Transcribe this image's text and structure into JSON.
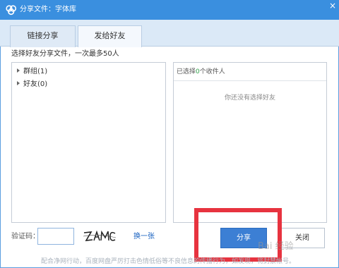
{
  "window": {
    "title": "分享文件：字体库",
    "close_glyph": "×",
    "app_icon": "cloud-icon",
    "accent_color": "#3a8fdf"
  },
  "tabs": [
    {
      "label": "链接分享",
      "active": false
    },
    {
      "label": "发给好友",
      "active": true
    }
  ],
  "instruction": "选择好友分享文件，一次最多50人",
  "contacts": {
    "groups_label": "群组(1)",
    "friends_label": "好友(0)"
  },
  "selected": {
    "prefix": "已选择",
    "count": "0",
    "suffix": "个收件人",
    "empty_text": "你还没有选择好友"
  },
  "captcha": {
    "label": "验证码：",
    "value": "",
    "refresh_label": "换一张"
  },
  "buttons": {
    "share_label": "分享",
    "close_label": "关闭",
    "share_color": "#3c7fd4"
  },
  "notice": "配合净网行动，百度网盘严厉打击色情低俗等不良信息的传播行为，如发现，将封禁帐号。",
  "watermark": "Bai 经验"
}
